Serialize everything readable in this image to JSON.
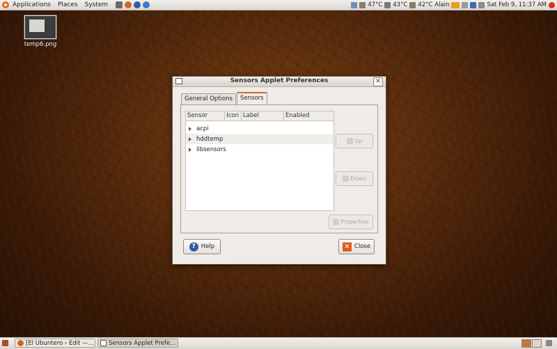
{
  "top_panel": {
    "menus": [
      "Applications",
      "Places",
      "System"
    ],
    "temps": [
      "47°C",
      "43°C",
      "42°C"
    ],
    "user": "Alain",
    "clock": "Sat Feb  9, 11:37 AM"
  },
  "desktop_icon": {
    "label": "temp6.png"
  },
  "window": {
    "title": "Sensors Applet Preferences",
    "tabs": [
      "General Options",
      "Sensors"
    ],
    "columns": [
      "Sensor",
      "Icon",
      "Label",
      "Enabled"
    ],
    "rows": [
      "acpi",
      "hddtemp",
      "libsensors"
    ],
    "buttons": {
      "up": "Up",
      "down": "Down",
      "properties": "Properties",
      "help": "Help",
      "close": "Close"
    }
  },
  "taskbar": {
    "tasks": [
      "[El Ubuntero › Edit —...",
      "Sensors Applet Prefe..."
    ]
  },
  "colors": {
    "accent": "#d26a1f",
    "close_icon": "#e05c1a",
    "help_icon": "#2d5da8"
  }
}
